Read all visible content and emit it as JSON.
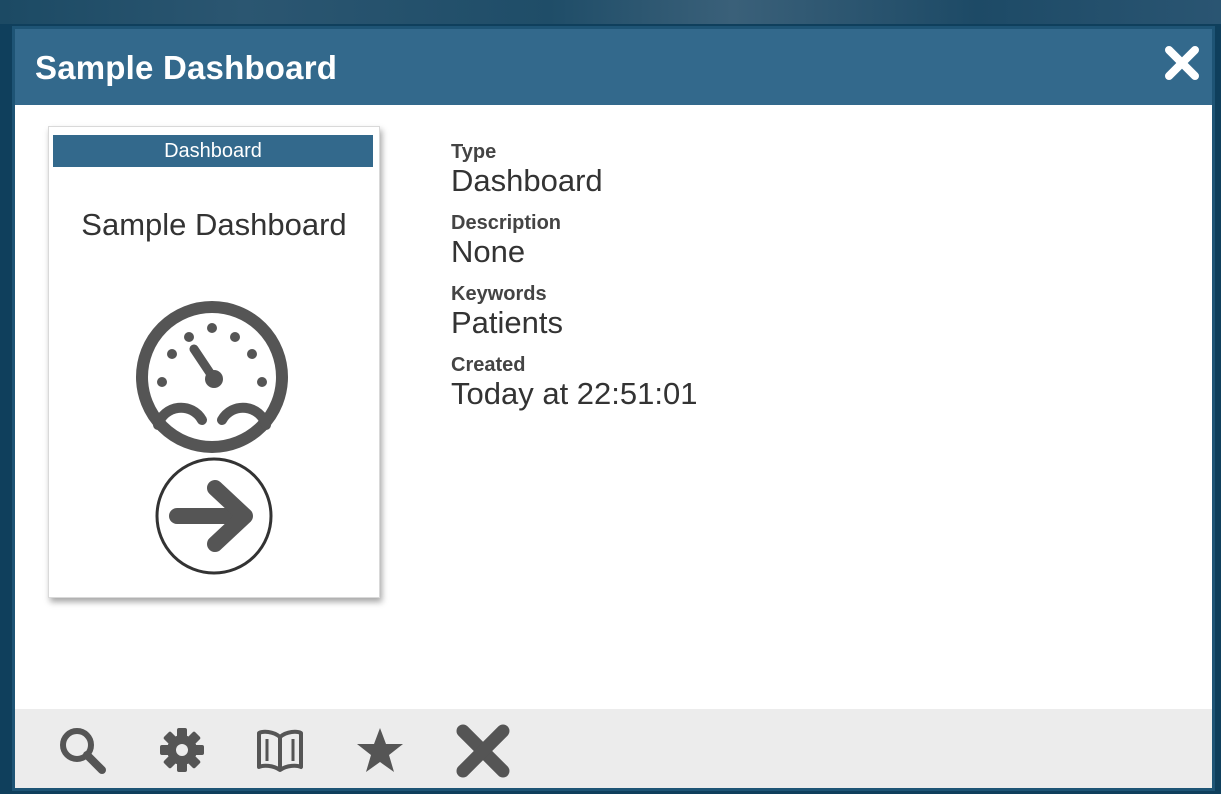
{
  "dialog": {
    "title": "Sample Dashboard",
    "close_icon": "close-icon"
  },
  "card": {
    "type_label": "Dashboard",
    "title": "Sample Dashboard",
    "icon": "dashboard-gauge-icon",
    "open_icon": "arrow-right-circle-icon"
  },
  "details": [
    {
      "label": "Type",
      "value": "Dashboard"
    },
    {
      "label": "Description",
      "value": "None"
    },
    {
      "label": "Keywords",
      "value": "Patients"
    },
    {
      "label": "Created",
      "value": "Today at 22:51:01"
    }
  ],
  "toolbar": [
    "search-icon",
    "gear-icon",
    "book-icon",
    "star-icon",
    "close-icon"
  ],
  "colors": {
    "titlebar": "#33698c",
    "frame": "#1e5475",
    "icon": "#555555",
    "footer": "#ececec"
  }
}
